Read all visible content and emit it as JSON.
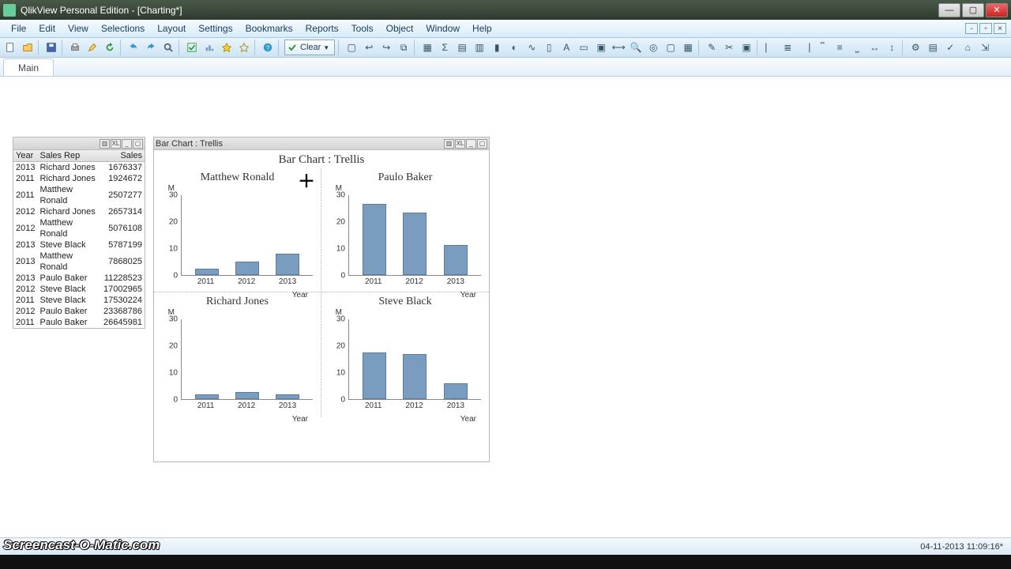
{
  "window": {
    "title": "QlikView Personal Edition - [Charting*]"
  },
  "menu": [
    "File",
    "Edit",
    "View",
    "Selections",
    "Layout",
    "Settings",
    "Bookmarks",
    "Reports",
    "Tools",
    "Object",
    "Window",
    "Help"
  ],
  "toolbar": {
    "clear_label": "Clear"
  },
  "tab": {
    "main": "Main"
  },
  "table": {
    "headers": [
      "Year",
      "Sales Rep",
      "Sales"
    ],
    "rows": [
      [
        "2013",
        "Richard Jones",
        "1676337"
      ],
      [
        "2011",
        "Richard Jones",
        "1924672"
      ],
      [
        "2011",
        "Matthew Ronald",
        "2507277"
      ],
      [
        "2012",
        "Richard Jones",
        "2657314"
      ],
      [
        "2012",
        "Matthew Ronald",
        "5076108"
      ],
      [
        "2013",
        "Steve Black",
        "5787199"
      ],
      [
        "2013",
        "Matthew Ronald",
        "7868025"
      ],
      [
        "2013",
        "Paulo Baker",
        "11228523"
      ],
      [
        "2012",
        "Steve Black",
        "17002965"
      ],
      [
        "2011",
        "Steve Black",
        "17530224"
      ],
      [
        "2012",
        "Paulo Baker",
        "23368786"
      ],
      [
        "2011",
        "Paulo Baker",
        "26645981"
      ]
    ]
  },
  "chartbox": {
    "header": "Bar Chart : Trellis",
    "title": "Bar Chart : Trellis"
  },
  "chart_data": [
    {
      "type": "bar",
      "title": "Matthew Ronald",
      "categories": [
        "2011",
        "2012",
        "2013"
      ],
      "values": [
        2.5,
        5.1,
        7.9
      ],
      "unit": "M",
      "ylim": [
        0,
        30
      ],
      "yticks": [
        0,
        10,
        20,
        30
      ],
      "xlabel": "Year"
    },
    {
      "type": "bar",
      "title": "Paulo Baker",
      "categories": [
        "2011",
        "2012",
        "2013"
      ],
      "values": [
        26.6,
        23.4,
        11.2
      ],
      "unit": "M",
      "ylim": [
        0,
        30
      ],
      "yticks": [
        0,
        10,
        20,
        30
      ],
      "xlabel": "Year"
    },
    {
      "type": "bar",
      "title": "Richard Jones",
      "categories": [
        "2011",
        "2012",
        "2013"
      ],
      "values": [
        1.9,
        2.7,
        1.7
      ],
      "unit": "M",
      "ylim": [
        0,
        30
      ],
      "yticks": [
        0,
        10,
        20,
        30
      ],
      "xlabel": "Year"
    },
    {
      "type": "bar",
      "title": "Steve Black",
      "categories": [
        "2011",
        "2012",
        "2013"
      ],
      "values": [
        17.5,
        17.0,
        5.8
      ],
      "unit": "M",
      "ylim": [
        0,
        30
      ],
      "yticks": [
        0,
        10,
        20,
        30
      ],
      "xlabel": "Year"
    }
  ],
  "status": {
    "datetime": "04-11-2013 11:09:16*"
  },
  "watermark": "Screencast-O-Matic.com"
}
